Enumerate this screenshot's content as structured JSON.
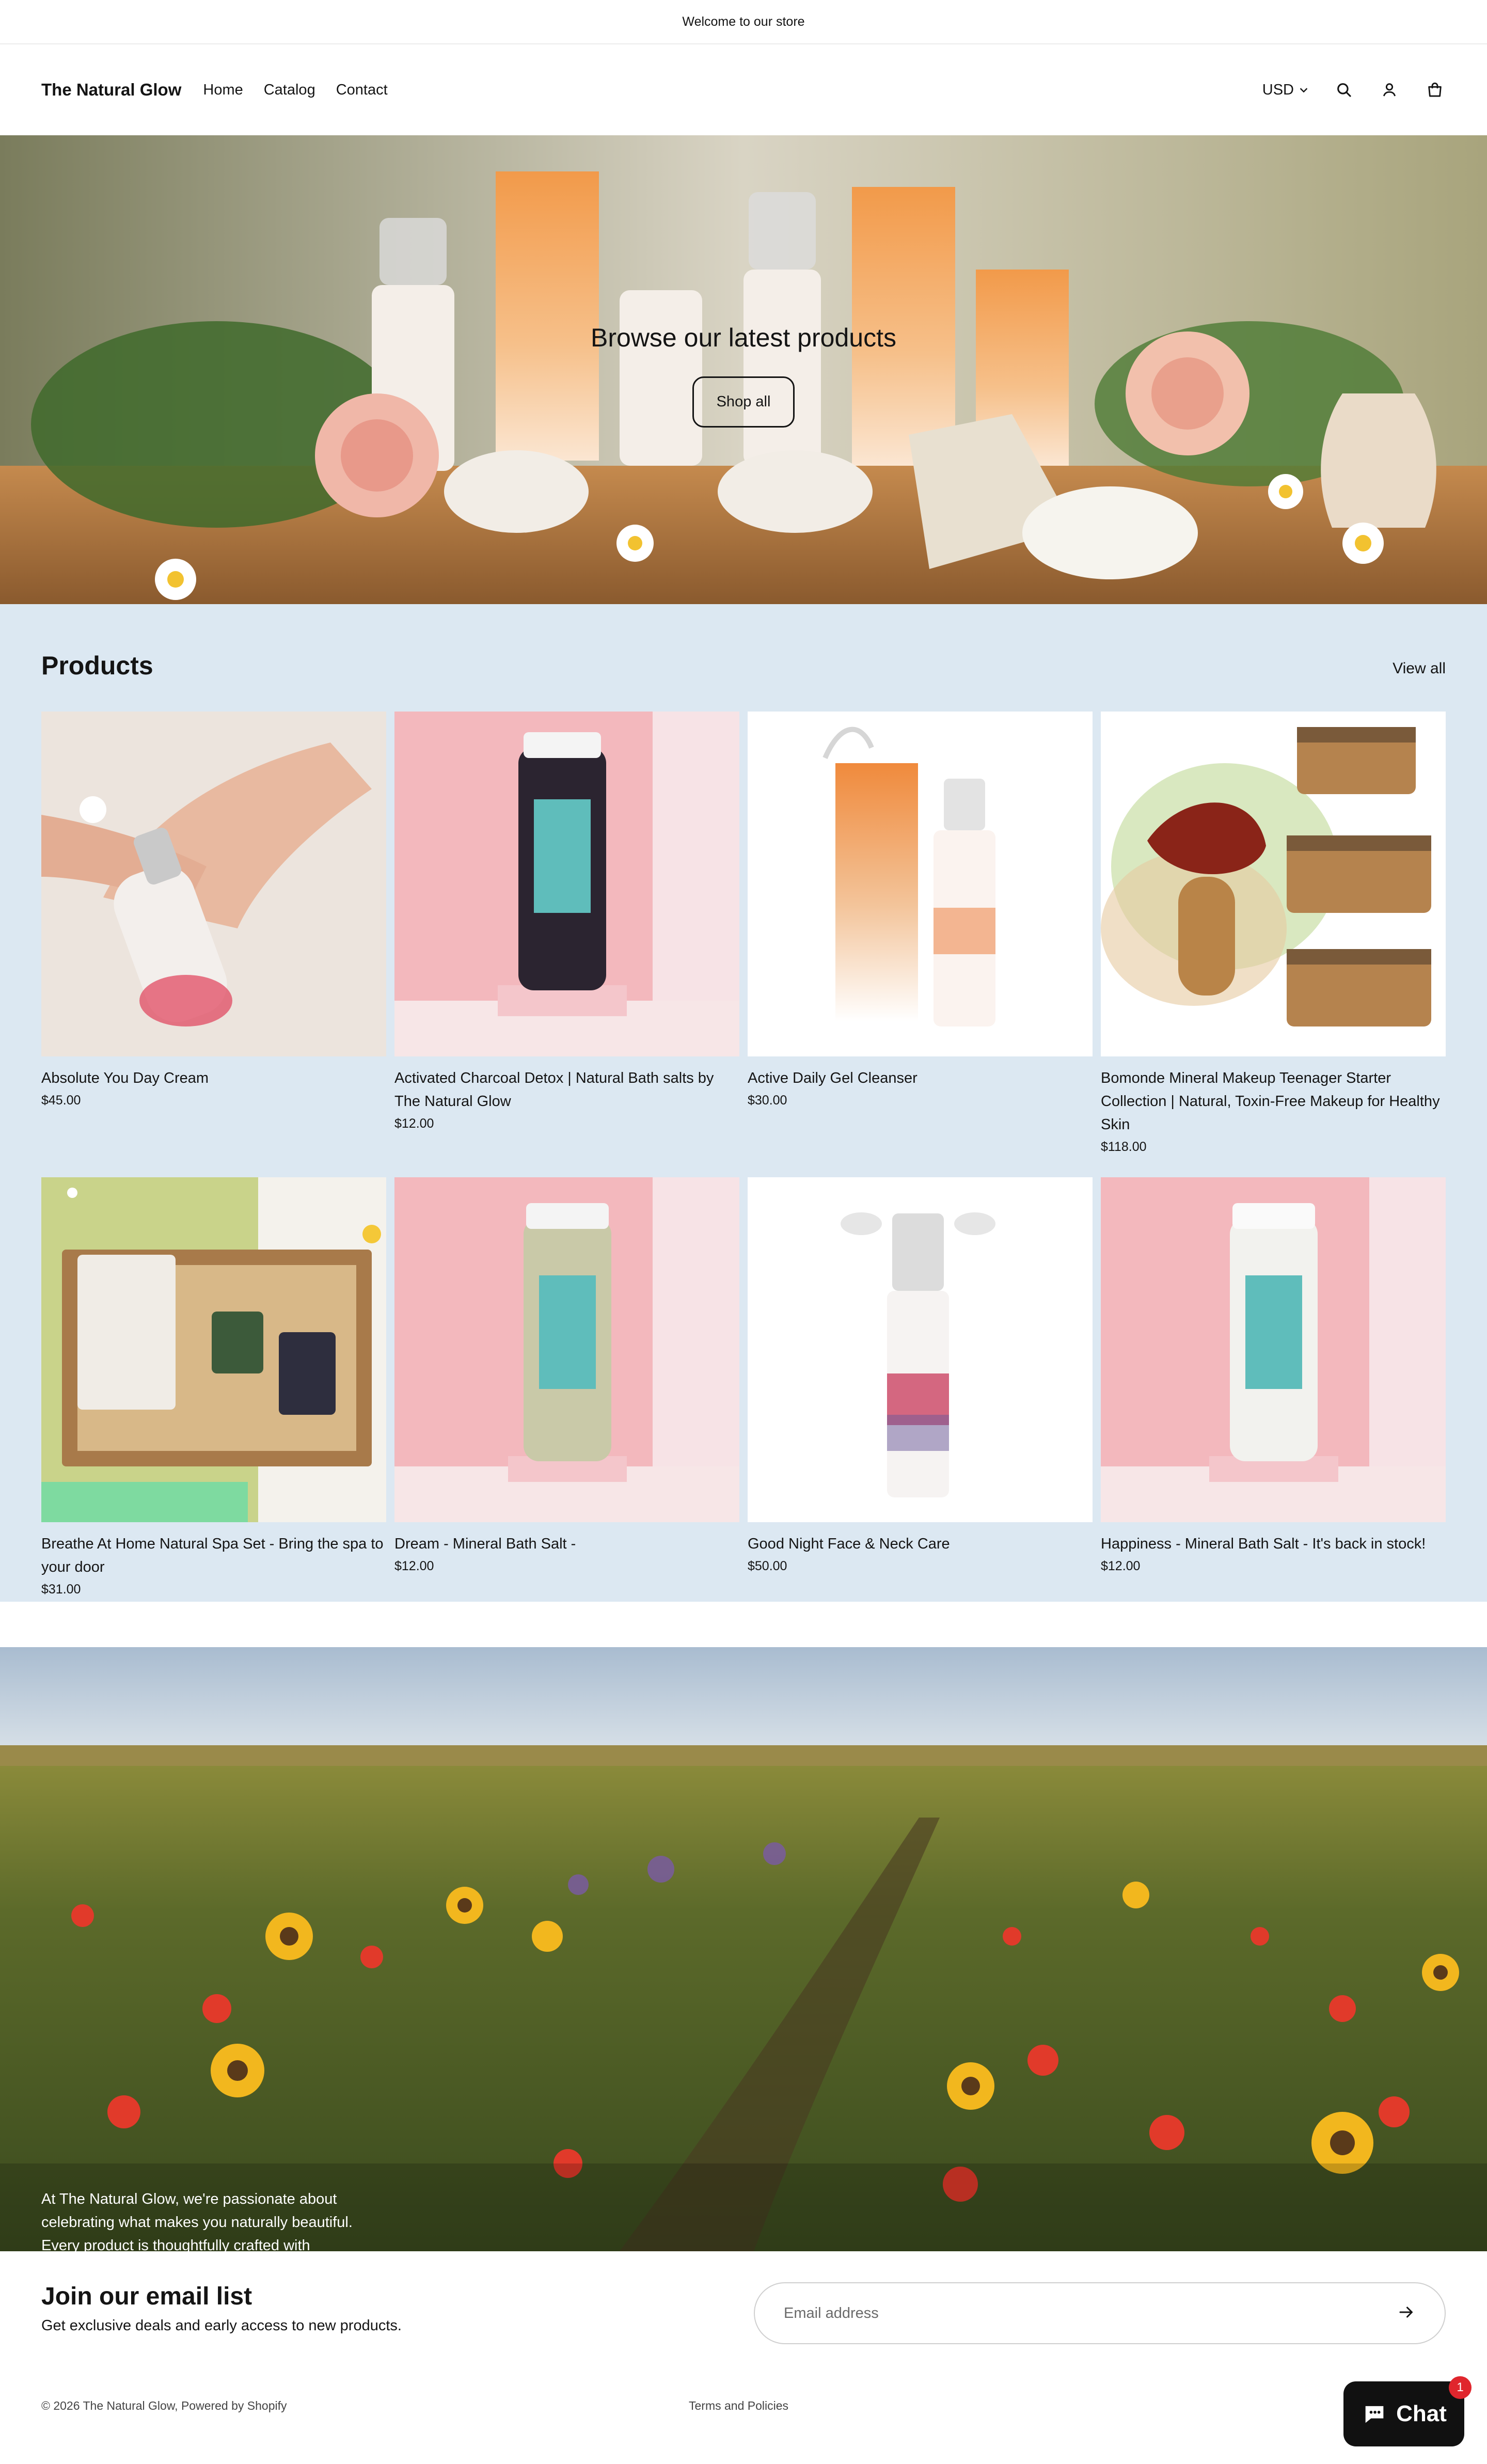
{
  "announcement": "Welcome to our store",
  "header": {
    "logo": "The Natural Glow",
    "nav": [
      "Home",
      "Catalog",
      "Contact"
    ],
    "currency": "USD",
    "icons": [
      "search-icon",
      "account-icon",
      "cart-icon",
      "chevron-down-icon"
    ]
  },
  "hero": {
    "heading": "Browse our latest products",
    "button": "Shop all"
  },
  "products": {
    "title": "Products",
    "view_all": "View all",
    "items": [
      {
        "title": "Absolute You Day Cream",
        "price": "$45.00"
      },
      {
        "title": "Activated Charcoal Detox | Natural Bath salts by The Natural Glow",
        "price": "$12.00"
      },
      {
        "title": "Active Daily Gel Cleanser",
        "price": "$30.00"
      },
      {
        "title": "Bomonde Mineral Makeup Teenager Starter Collection | Natural, Toxin-Free Makeup for Healthy Skin",
        "price": "$118.00"
      },
      {
        "title": "Breathe At Home Natural Spa Set - Bring the spa to your door",
        "price": "$31.00"
      },
      {
        "title": "Dream - Mineral Bath Salt -",
        "price": "$12.00"
      },
      {
        "title": "Good Night Face & Neck Care",
        "price": "$50.00"
      },
      {
        "title": "Happiness - Mineral Bath Salt - It's back in stock!",
        "price": "$12.00"
      }
    ]
  },
  "banner": {
    "text": "At The Natural Glow, we're passionate about celebrating what makes you naturally beautiful. Every product is thoughtfully crafted with"
  },
  "newsletter": {
    "title": "Join our email list",
    "subtitle": "Get exclusive deals and early access to new products.",
    "placeholder": "Email address"
  },
  "footer": {
    "copyright": "© 2026 The Natural Glow, Powered by Shopify",
    "links": "Terms and Policies"
  },
  "chat": {
    "label": "Chat",
    "badge": "1"
  }
}
